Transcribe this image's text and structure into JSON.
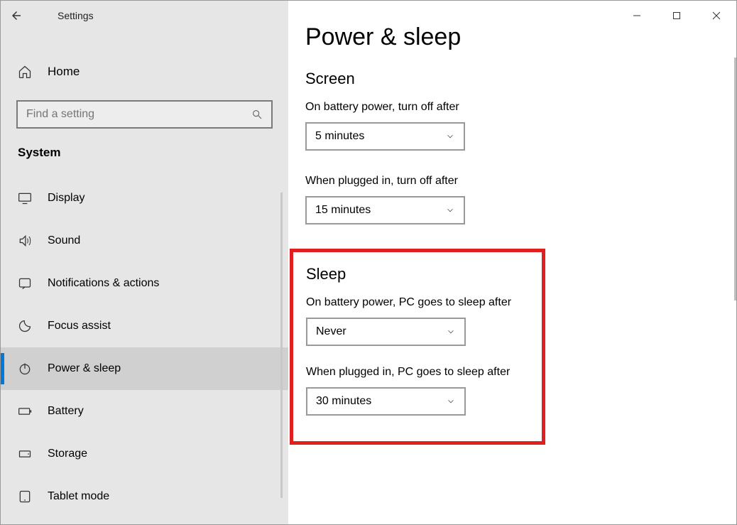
{
  "app_title": "Settings",
  "home_label": "Home",
  "search_placeholder": "Find a setting",
  "category_label": "System",
  "nav": [
    {
      "id": "display",
      "label": "Display"
    },
    {
      "id": "sound",
      "label": "Sound"
    },
    {
      "id": "notifications",
      "label": "Notifications & actions"
    },
    {
      "id": "focus-assist",
      "label": "Focus assist"
    },
    {
      "id": "power-sleep",
      "label": "Power & sleep",
      "selected": true
    },
    {
      "id": "battery",
      "label": "Battery"
    },
    {
      "id": "storage",
      "label": "Storage"
    },
    {
      "id": "tablet-mode",
      "label": "Tablet mode"
    }
  ],
  "page": {
    "title": "Power & sleep",
    "sections": {
      "screen": {
        "title": "Screen",
        "battery_label": "On battery power, turn off after",
        "battery_value": "5 minutes",
        "plugged_label": "When plugged in, turn off after",
        "plugged_value": "15 minutes"
      },
      "sleep": {
        "title": "Sleep",
        "battery_label": "On battery power, PC goes to sleep after",
        "battery_value": "Never",
        "plugged_label": "When plugged in, PC goes to sleep after",
        "plugged_value": "30 minutes"
      }
    }
  }
}
